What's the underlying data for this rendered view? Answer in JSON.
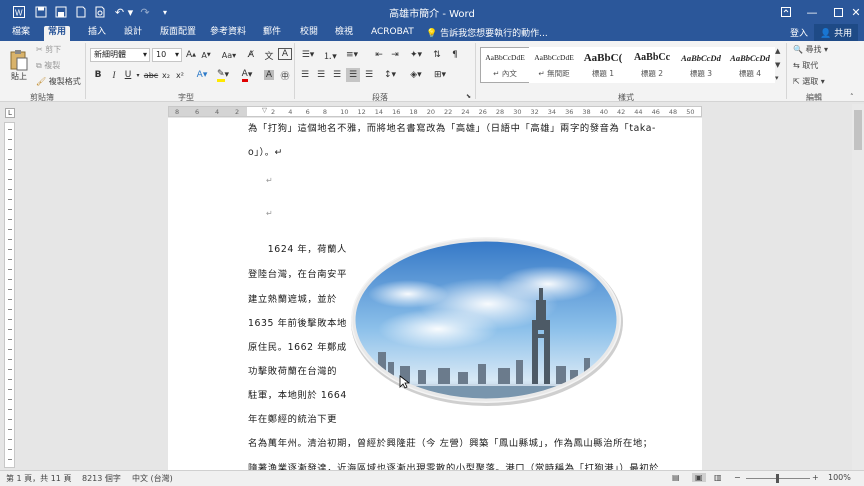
{
  "window": {
    "title": "高雄市簡介 - Word",
    "colors": {
      "brand": "#2b579a",
      "ribbon": "#f3f3f3",
      "canvas": "#e6e6e6"
    }
  },
  "qat": {
    "icons": [
      "word-logo-icon",
      "save-icon",
      "save-as-icon",
      "new-file-icon",
      "print-preview-icon",
      "undo-icon",
      "redo-icon",
      "customize-qat-icon"
    ]
  },
  "tabs": {
    "file": "檔案",
    "home": "常用",
    "insert": "插入",
    "design": "設計",
    "layout": "版面配置",
    "references": "參考資料",
    "mailings": "郵件",
    "review": "校閱",
    "view": "檢視",
    "acrobat": "ACROBAT",
    "tellme": "告訴我您想要執行的動作...",
    "login": "登入",
    "share": "共用"
  },
  "ribbon": {
    "clipboard": {
      "label": "剪貼簿",
      "paste": "貼上",
      "cut": "剪下",
      "copy": "複製",
      "format_painter": "複製格式"
    },
    "font": {
      "label": "字型",
      "name": "新細明體",
      "size": "10",
      "bold": "B",
      "italic": "I",
      "underline": "U",
      "strike": "abc",
      "sub": "x₂",
      "sup": "x²"
    },
    "paragraph": {
      "label": "段落"
    },
    "styles": {
      "label": "樣式",
      "items": [
        {
          "sample": "AaBbCcDdE",
          "name": "↵ 內文"
        },
        {
          "sample": "AaBbCcDdE",
          "name": "↵ 無間距"
        },
        {
          "sample": "AaBbC(",
          "name": "標題 1"
        },
        {
          "sample": "AaBbCc",
          "name": "標題 2"
        },
        {
          "sample": "AaBbCcDd",
          "name": "標題 3"
        },
        {
          "sample": "AaBbCcDd",
          "name": "標題 4"
        }
      ]
    },
    "editing": {
      "label": "編輯",
      "find": "尋找",
      "replace": "取代",
      "select": "選取"
    }
  },
  "ruler": {
    "left": [
      "8",
      "6",
      "4",
      "2"
    ],
    "right": [
      "2",
      "4",
      "6",
      "8",
      "10",
      "12",
      "14",
      "16",
      "18",
      "20",
      "22",
      "24",
      "26",
      "28",
      "30",
      "32",
      "34",
      "36",
      "38",
      "40",
      "42",
      "44",
      "46",
      "48",
      "50"
    ]
  },
  "document": {
    "lines": {
      "l1": "為「打狗」這個地名不雅，而將地名書寫改為「高雄」（日語中「高雄」兩字的發音為「taka-",
      "l2": "o」）。↵",
      "p1": "↵",
      "p2": "↵",
      "w1": "　　1624 年，荷蘭人",
      "w2": "登陸台灣，在台南安平",
      "w3": "建立熱蘭遮城，並於",
      "w4": "1635 年前後擊敗本地",
      "w5": "原住民。1662 年鄭成",
      "w6": "功擊敗荷蘭在台灣的",
      "w7": "駐軍，本地則於 1664",
      "w8": "年在鄭經的統治下更",
      "f1": "名為萬年州。清治初期，曾經於興隆莊（今 左營）興築「鳳山縣城」，作為鳳山縣治所在地；",
      "f2": "隨著漁業逐漸發達，近海區域也逐漸出現零散的小型聚落。港口（當時稱為「打狗港」）最初於"
    },
    "image": {
      "alt": "高雄天際線與八五大樓照片（橢圓形框）"
    }
  },
  "status": {
    "page": "第 1 頁，共 11 頁",
    "words": "8213 個字",
    "lang": "中文 (台灣)",
    "zoom": "100%"
  }
}
